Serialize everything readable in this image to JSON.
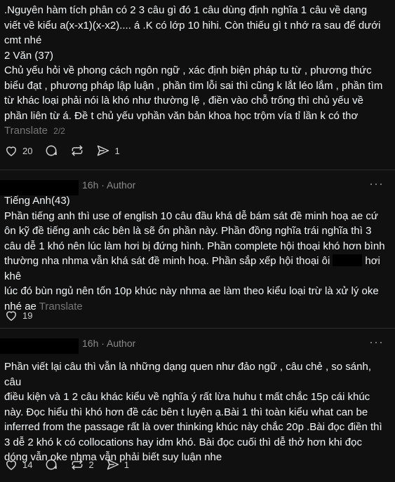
{
  "post1": {
    "lines": [
      ".Nguyên hàm tích phân có 2 3 câu gì đó 1 câu dùng định nghĩa 1 câu về dạng",
      "viết về kiểu a(x-x1)(x-x2).... á .K có lớp 10 hihi. Còn thiếu gì t nhớ ra sau để dưới",
      "cmt nhé",
      "2 Văn (37)",
      "Chủ yếu hỏi về phong cách ngôn ngữ , xác định biện pháp tu từ , phương thức",
      "biểu đạt , phương pháp lập luận , phần tìm lỗi sai thì cũng k lắt léo lắm , phần tìm",
      "từ khác loại phải nói là khó như thường lệ , điền vào chỗ trống thì chủ yếu về",
      "phần liên từ á. Đề t chủ yếu vphần văn bản khoa học trộm vía tỉ lần k có thơ"
    ],
    "translate": "Translate",
    "page_indicator": "2/2",
    "likes": "20",
    "reposts": "",
    "comments": "",
    "shares": "1"
  },
  "post2": {
    "time": "16h",
    "author_badge": "Author",
    "more": "···",
    "title": "Tiếng Anh(43)",
    "lines": [
      "Phần tiếng anh thì use of english 10 câu đầu khá dễ bám sát đề minh hoạ ae cứ",
      "ôn kỹ đề tiếng anh các bên là sẽ ổn phần này. Phần đồng nghĩa trái nghĩa thì 3",
      "câu dễ 1 khó nên lúc làm hơi bị đứng hình. Phần complete hội thoại khó hơn bình",
      "thường nha nhma vẫn khá sát đề minh hoạ. Phần sắp xếp hội thoại ôi"
    ],
    "line5_after": "hơi khê",
    "line6": "lúc đó bùn ngủ nên tốn 10p khúc này nhma ae làm theo kiểu loại trừ là xử lý oke",
    "line7": "nhé ae",
    "translate": "Translate",
    "likes": "19"
  },
  "post3": {
    "time": "16h",
    "author_badge": "Author",
    "more": "···",
    "lines": [
      "Phần viết lại câu thì vẫn là những dạng quen như đảo ngữ , câu chẻ , so sánh, câu",
      "điều kiện và 1 2 câu khác kiểu về nghĩa ý rất lừa huhu t mất chắc 15p cái khúc",
      "này. Đọc hiểu thì khó hơn đề các bên t luyện ạ.Bài 1 thì toàn kiểu what can be",
      "inferred from the passage rất là over thinking khúc này chắc 20p .Bài đọc điền thì",
      "3 dễ 2 khó k có collocations hay idm khó. Bài đọc cuối thì dễ thở hơn khi đọc",
      "dóng vẫn oke nhma vẫn phải biết suy luận nhe"
    ],
    "likes": "14",
    "reposts": "2",
    "shares": "1"
  },
  "colors": {
    "background": "#101010",
    "text": "#f3f5f7",
    "muted": "#777777",
    "divider": "#2d2d2d"
  }
}
